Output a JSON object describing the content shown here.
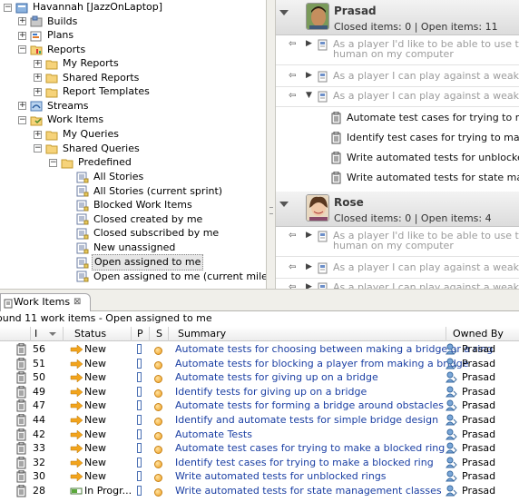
{
  "tree": {
    "root": "Havannah [JazzOnLaptop]",
    "items": [
      {
        "label": "Builds",
        "icon": "builds-icon"
      },
      {
        "label": "Plans",
        "icon": "plans-icon"
      },
      {
        "label": "Reports",
        "icon": "reports-folder-icon"
      },
      {
        "label": "My Reports",
        "icon": "folder-icon"
      },
      {
        "label": "Shared Reports",
        "icon": "folder-icon"
      },
      {
        "label": "Report Templates",
        "icon": "folder-icon"
      },
      {
        "label": "Streams",
        "icon": "streams-icon"
      },
      {
        "label": "Work Items",
        "icon": "work-items-icon"
      },
      {
        "label": "My Queries",
        "icon": "folder-icon"
      },
      {
        "label": "Shared Queries",
        "icon": "folder-icon"
      },
      {
        "label": "Predefined",
        "icon": "folder-icon"
      },
      {
        "label": "All Stories",
        "icon": "query-icon"
      },
      {
        "label": "All Stories (current sprint)",
        "icon": "query-icon"
      },
      {
        "label": "Blocked Work Items",
        "icon": "query-icon"
      },
      {
        "label": "Closed created by me",
        "icon": "query-icon"
      },
      {
        "label": "Closed subscribed by me",
        "icon": "query-icon"
      },
      {
        "label": "New unassigned",
        "icon": "query-icon"
      },
      {
        "label": "Open assigned to me",
        "icon": "query-icon"
      },
      {
        "label": "Open assigned to me (current milestone)",
        "icon": "query-icon"
      }
    ]
  },
  "team": {
    "members": [
      {
        "name": "Prasad",
        "stats": "Closed items: 0 | Open items: 11",
        "plans": [
          {
            "text": "As a player I'd like to be able to use the system",
            "text2": "human on my computer"
          },
          {
            "text": "As a player I can play against a weak engine that"
          },
          {
            "text": "As a player I can play against a weak engine that"
          }
        ],
        "children": [
          "Automate test cases for trying to make a b",
          "Identify test cases for trying to make a blo",
          "Write automated tests for unblocked rings",
          "Write automated tests for state manageme"
        ]
      },
      {
        "name": "Rose",
        "stats": "Closed items: 0 | Open items: 4",
        "plans": [
          {
            "text": "As a player I'd like to be able to use the system",
            "text2": "human on my computer"
          },
          {
            "text": "As a player I can play against a weak engine that"
          },
          {
            "text": "As a player I can play against a weak engine that"
          }
        ]
      }
    ]
  },
  "workitems": {
    "tab_label": "Work Items",
    "tab_close": "⊠",
    "summary": "ound 11 work items - Open assigned to me",
    "columns": {
      "id": "I",
      "status": "Status",
      "p": "P",
      "s": "S",
      "summary": "Summary",
      "owner": "Owned By"
    },
    "rows": [
      {
        "id": "56",
        "status": "New",
        "summary": "Automate tests for choosing between making a bridge or a ring",
        "owner": "Prasad"
      },
      {
        "id": "51",
        "status": "New",
        "summary": "Automate tests for blocking a player from making a bridge",
        "owner": "Prasad"
      },
      {
        "id": "50",
        "status": "New",
        "summary": "Automate tests for giving up on a bridge",
        "owner": "Prasad"
      },
      {
        "id": "49",
        "status": "New",
        "summary": "Identify tests for giving up on a bridge",
        "owner": "Prasad"
      },
      {
        "id": "47",
        "status": "New",
        "summary": "Automate tests for forming a bridge around obstacles",
        "owner": "Prasad"
      },
      {
        "id": "44",
        "status": "New",
        "summary": "Identify and automate tests for simple bridge design",
        "owner": "Prasad"
      },
      {
        "id": "42",
        "status": "New",
        "summary": "Automate Tests",
        "owner": "Prasad"
      },
      {
        "id": "33",
        "status": "New",
        "summary": "Automate test cases for trying to make a blocked ring",
        "owner": "Prasad"
      },
      {
        "id": "32",
        "status": "New",
        "summary": "Identify test cases for trying to make a blocked ring",
        "owner": "Prasad"
      },
      {
        "id": "30",
        "status": "New",
        "summary": "Write automated tests for unblocked rings",
        "owner": "Prasad"
      },
      {
        "id": "28",
        "status": "In Progr...",
        "summary": "Write automated tests for state management classes",
        "owner": "Prasad"
      }
    ]
  },
  "colors": {
    "link": "#1b3fa3",
    "status_arrow": "#f2a41c",
    "panel_bg": "#f0efea"
  }
}
